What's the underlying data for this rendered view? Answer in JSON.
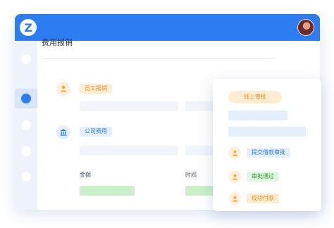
{
  "app": {
    "logo_letter": "Z"
  },
  "page": {
    "title": "费用报销"
  },
  "sections": {
    "employee": {
      "label": "员工报销"
    },
    "company": {
      "label": "公司费用"
    }
  },
  "fields": {
    "amount_label": "金额",
    "time_label": "时间"
  },
  "approval_card": {
    "header_label": "线上审批",
    "steps": [
      {
        "label": "提交借款审批",
        "color": "blue"
      },
      {
        "label": "审批通过",
        "color": "green"
      },
      {
        "label": "成功付款",
        "color": "orange"
      }
    ]
  },
  "colors": {
    "primary": "#2d7df2",
    "sidebar_bg": "#eef3fb",
    "orange_accent": "#f5a623",
    "green_accent": "#c9f0c9"
  },
  "icons": {
    "logo": "z-logo-icon",
    "employee": "person-icon",
    "company": "bank-icon",
    "step": "person-icon"
  }
}
